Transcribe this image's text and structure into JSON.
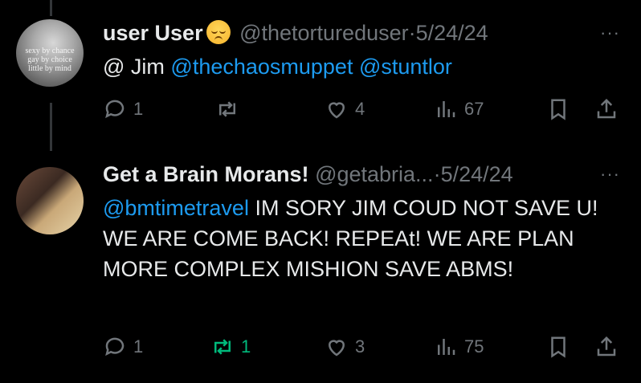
{
  "tweets": [
    {
      "avatar_text": "sexy by chance\ngay by choice\nlittle by mind",
      "name": "user User",
      "handle": "@thetortureduser",
      "sep": "·",
      "date": "5/24/24",
      "body_prefix": "@ Jim ",
      "mention1": "@thechaosmuppet",
      "mention2": " @stuntlor",
      "replies": "1",
      "retweets": "",
      "likes": "4",
      "views": "67"
    },
    {
      "name": "Get a Brain Morans!",
      "handle": "@getabria...",
      "sep": "·",
      "date": "5/24/24",
      "mention": "@bmtimetravel",
      "body_text": " IM SORY JIM COUD NOT SAVE U! WE ARE COME BACK! REPEAt! WE ARE PLAN MORE COMPLEX MISHION SAVE ABMS!",
      "replies": "1",
      "retweets": "1",
      "likes": "3",
      "views": "75"
    }
  ],
  "more_label": "···",
  "colors": {
    "link": "#1d9bf0",
    "muted": "#71767b",
    "retweet_active": "#00ba7c"
  },
  "icons": [
    "reply-icon",
    "retweet-icon",
    "like-icon",
    "views-icon",
    "bookmark-icon",
    "share-icon",
    "more-icon",
    "pensive-emoji-icon"
  ]
}
